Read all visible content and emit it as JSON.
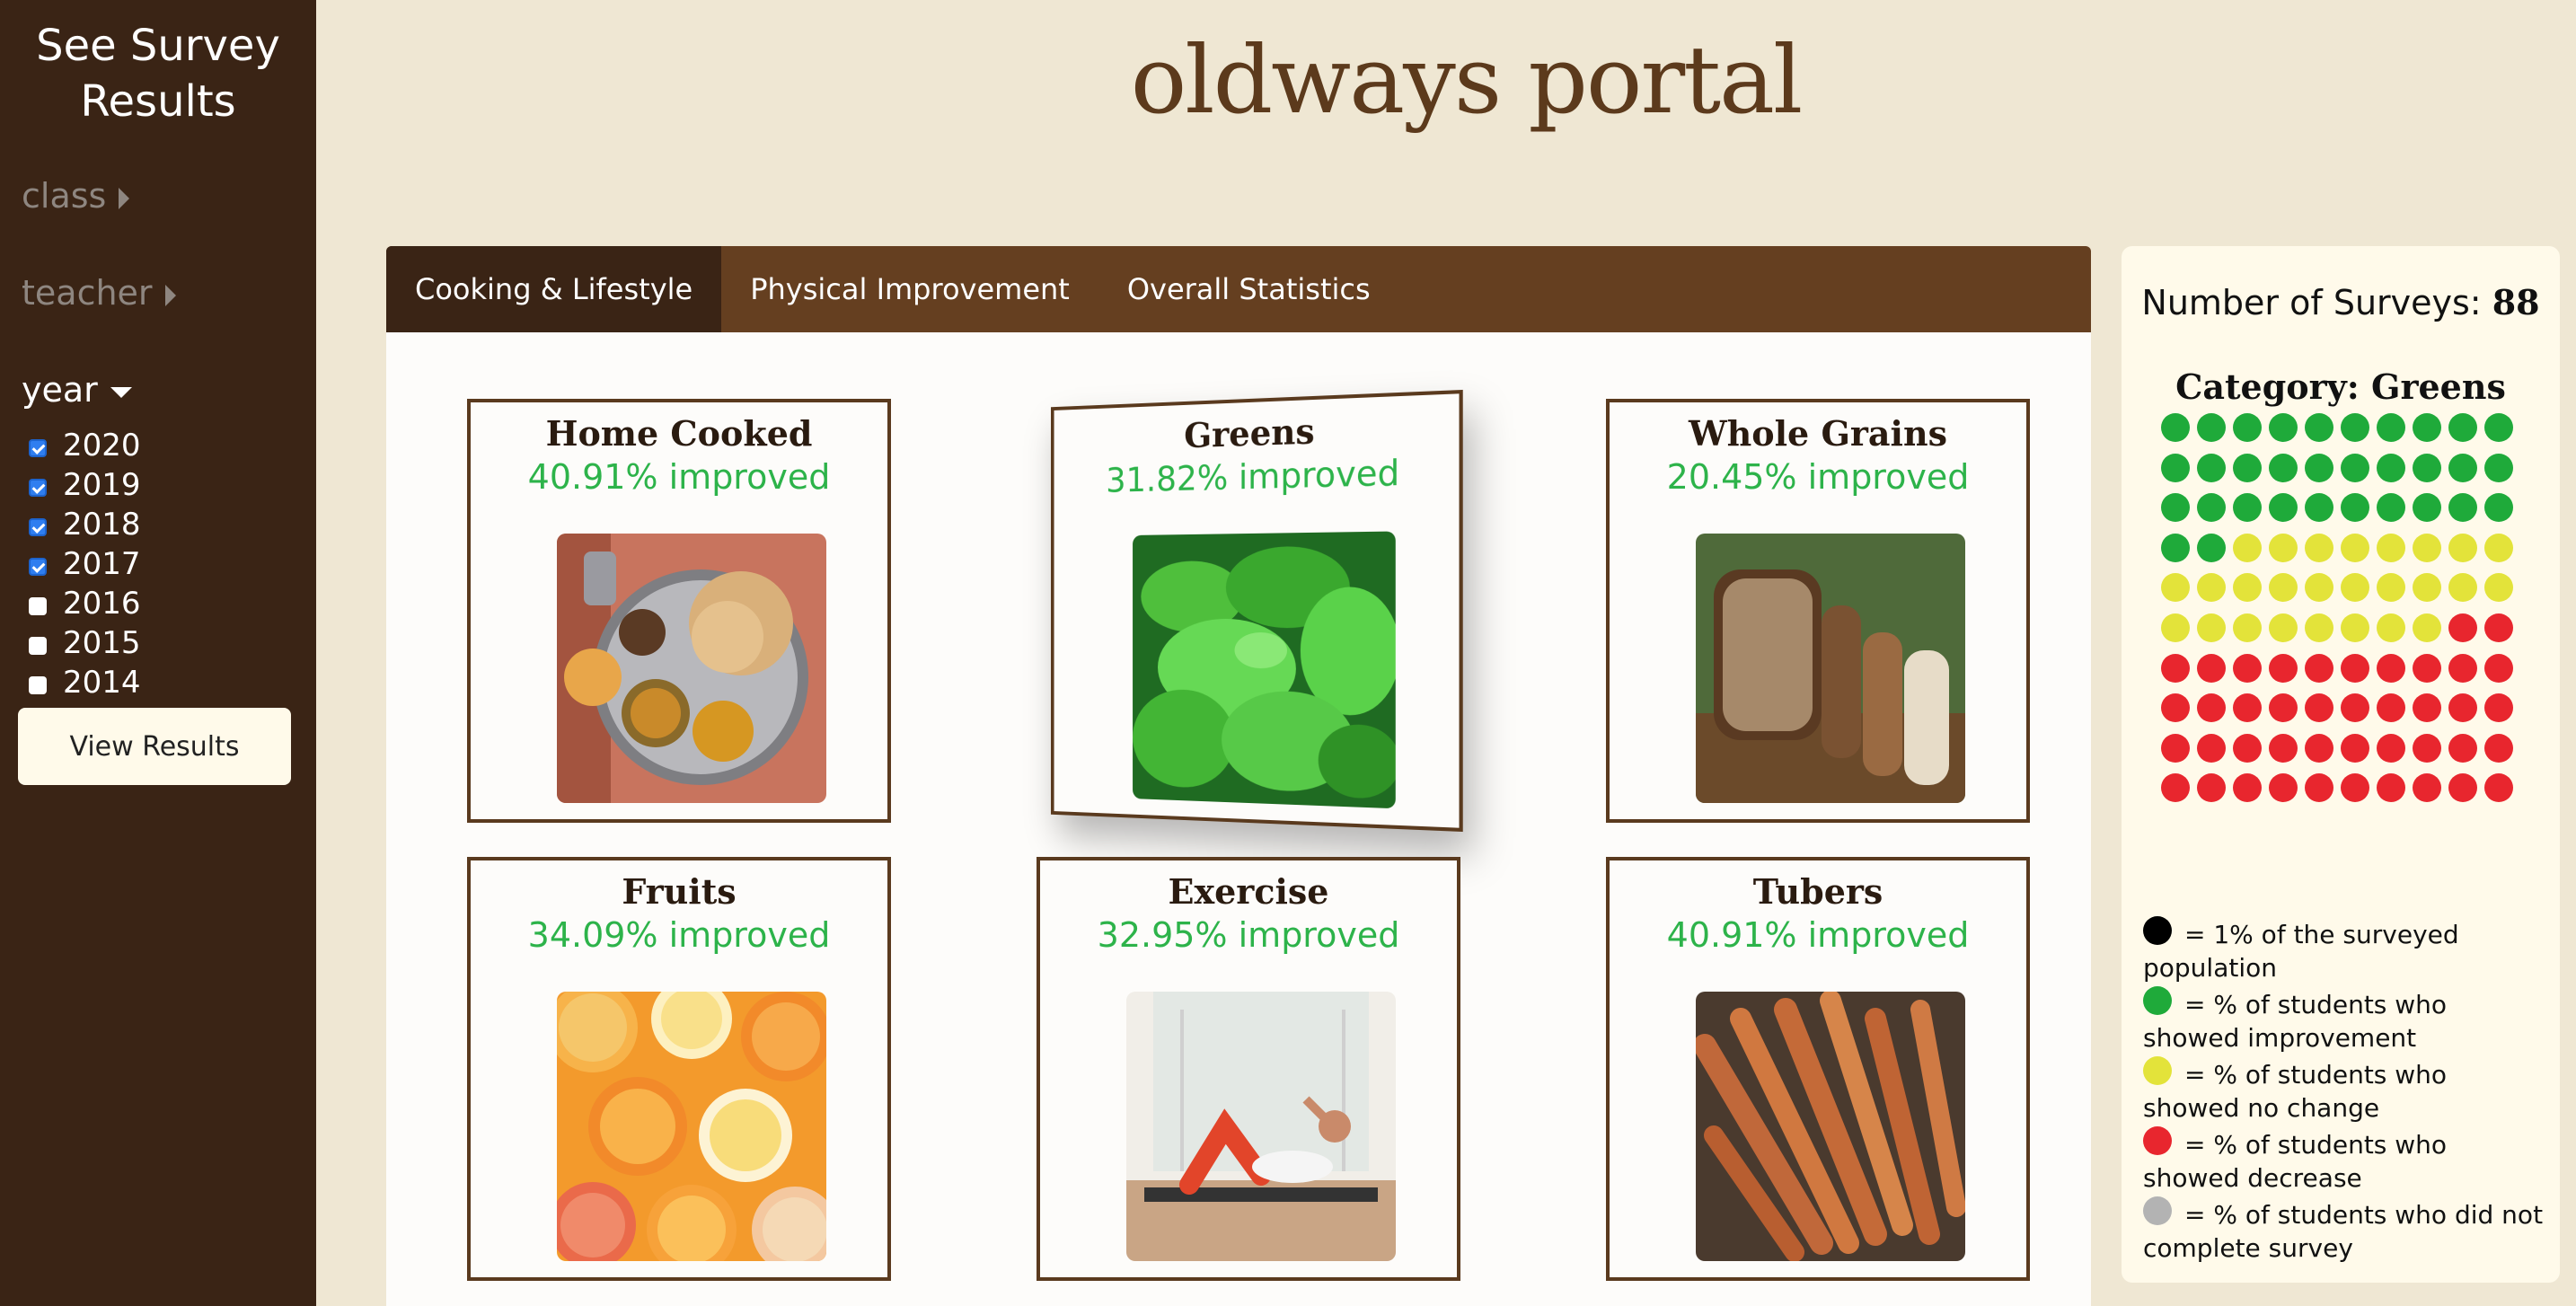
{
  "sidebar": {
    "title": "See Survey Results",
    "filters": {
      "class": "class",
      "teacher": "teacher",
      "year": "year"
    },
    "years": [
      {
        "label": "2020",
        "checked": true
      },
      {
        "label": "2019",
        "checked": true
      },
      {
        "label": "2018",
        "checked": true
      },
      {
        "label": "2017",
        "checked": true
      },
      {
        "label": "2016",
        "checked": false
      },
      {
        "label": "2015",
        "checked": false
      },
      {
        "label": "2014",
        "checked": false
      }
    ],
    "view_button": "View Results"
  },
  "header": {
    "title": "oldways portal"
  },
  "tabs": [
    "Cooking & Lifestyle",
    "Physical Improvement",
    "Overall Statistics"
  ],
  "cards": [
    {
      "title": "Home Cooked",
      "stat": "40.91% improved",
      "image": "thali-plate-photo"
    },
    {
      "title": "Greens",
      "stat": "31.82% improved",
      "image": "spinach-photo"
    },
    {
      "title": "Whole Grains",
      "stat": "20.45% improved",
      "image": "bread-photo"
    },
    {
      "title": "Fruits",
      "stat": "34.09% improved",
      "image": "citrus-slices-photo"
    },
    {
      "title": "Exercise",
      "stat": "32.95% improved",
      "image": "exercise-photo"
    },
    {
      "title": "Tubers",
      "stat": "40.91% improved",
      "image": "carrots-photo"
    }
  ],
  "panel": {
    "surveys_label": "Number of Surveys:",
    "surveys_count": "88",
    "category_label": "Category: Greens",
    "dot_counts": {
      "improved": 32,
      "no_change": 26,
      "decrease": 42
    },
    "colors": {
      "improved": "#1faa3a",
      "no_change": "#e3e33a",
      "decrease": "#e8262e",
      "not_completed": "#b3b3b3",
      "unit": "#000000"
    },
    "legend": [
      {
        "color": "unit",
        "text": "= 1% of the surveyed population"
      },
      {
        "color": "improved",
        "text": "= % of students who showed improvement"
      },
      {
        "color": "no_change",
        "text": "= % of students who showed no change"
      },
      {
        "color": "decrease",
        "text": "= % of students who showed decrease"
      },
      {
        "color": "not_completed",
        "text": "= % of students who did not complete survey"
      }
    ]
  },
  "theme": {
    "sidebar_bg": "#3a2415",
    "tabbar_bg": "#653f20",
    "accent_green": "#2db34a",
    "title_brown": "#5c3a1c"
  }
}
